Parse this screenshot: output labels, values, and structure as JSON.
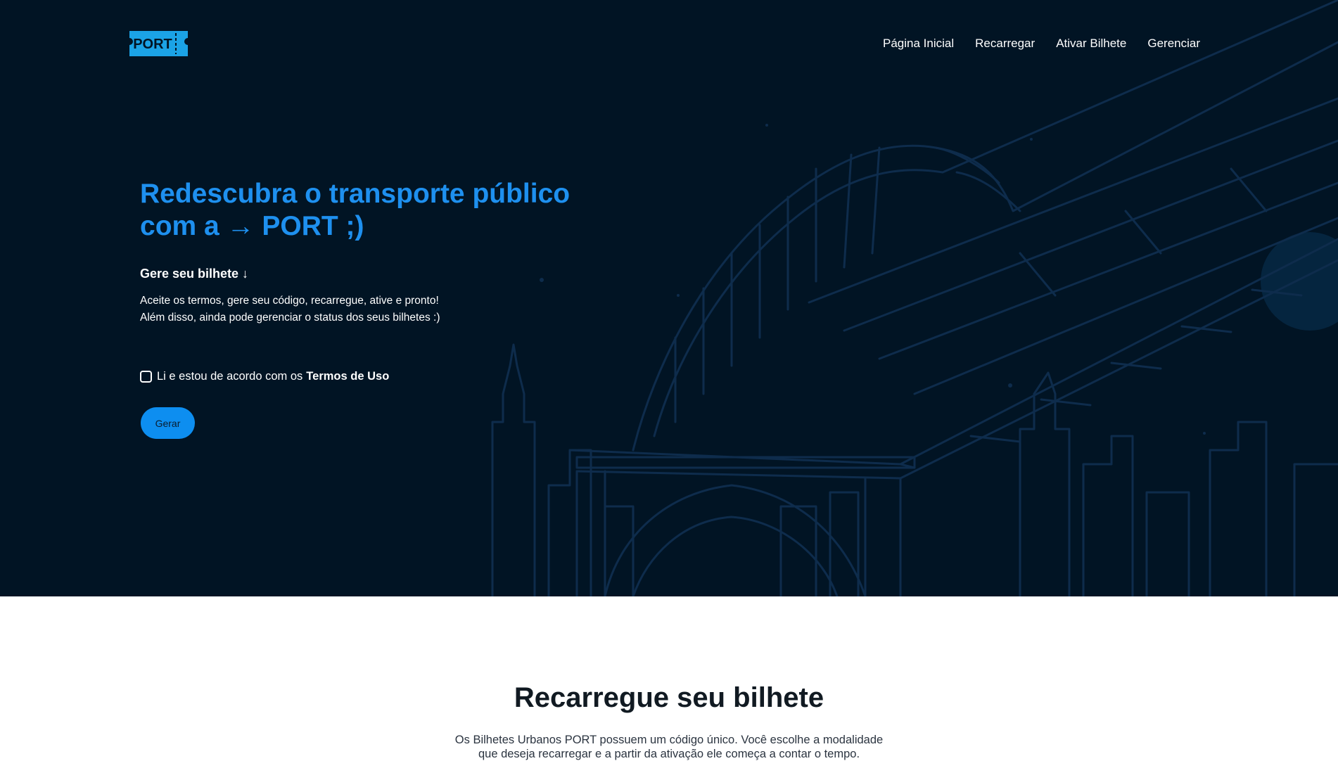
{
  "brand": {
    "logo_text": "PORT"
  },
  "nav": {
    "items": [
      {
        "label": "Página Inicial"
      },
      {
        "label": "Recarregar"
      },
      {
        "label": "Ativar Bilhete"
      },
      {
        "label": "Gerenciar"
      }
    ]
  },
  "hero": {
    "title_line1": "Redescubra o transporte público",
    "title_line2": "com a → PORT ;)",
    "subtitle": "Gere seu bilhete ↓",
    "description": "Aceite os termos, gere seu código, recarregue, ative e pronto! Além disso, ainda pode gerenciar o status dos seus bilhetes :)",
    "terms_prefix": "Li e estou de acordo com os",
    "terms_link": "Termos de Uso",
    "terms_checked": false,
    "button_label": "Gerar"
  },
  "recharge": {
    "title": "Recarregue seu bilhete",
    "text": "Os Bilhetes Urbanos PORT possuem um código único. Você escolhe a modalidade que deseja recarregar e a partir da ativação ele começa a contar o tempo."
  },
  "colors": {
    "hero_background": "#011424",
    "accent": "#1e90ef",
    "button": "#0d8ef0",
    "line_art": "#0e2c4c"
  }
}
